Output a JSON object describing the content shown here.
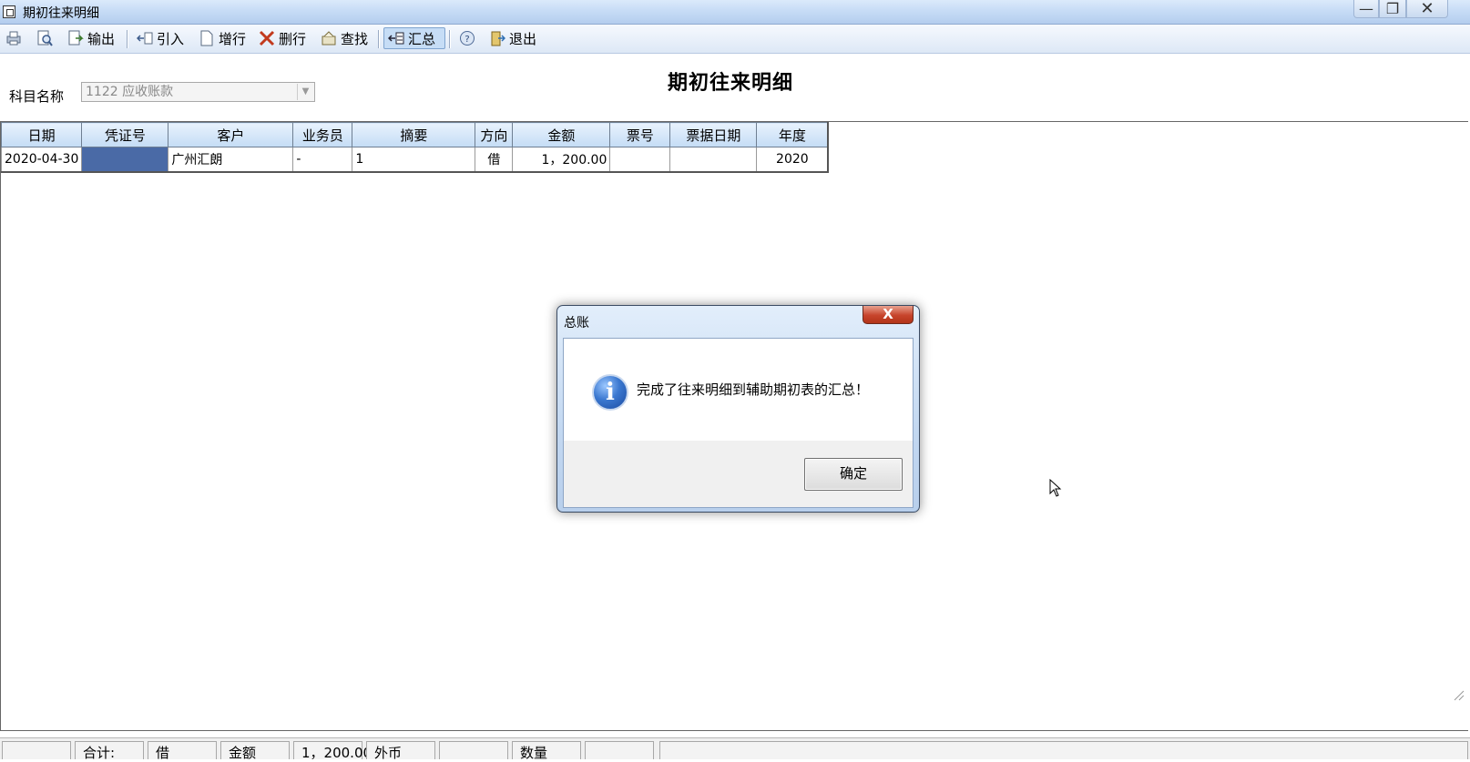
{
  "window": {
    "title": "期初往来明细",
    "controls": {
      "minimize": "—",
      "maximize": "❐",
      "close": "✕"
    }
  },
  "toolbar": {
    "items": [
      {
        "name": "print",
        "label": ""
      },
      {
        "name": "preview",
        "label": ""
      },
      {
        "name": "export",
        "label": "输出"
      },
      {
        "name": "import",
        "label": "引入"
      },
      {
        "name": "add-row",
        "label": "增行"
      },
      {
        "name": "delete-row",
        "label": "删行"
      },
      {
        "name": "find",
        "label": "查找"
      },
      {
        "name": "summarize",
        "label": "汇总"
      },
      {
        "name": "help",
        "label": ""
      },
      {
        "name": "exit",
        "label": "退出"
      }
    ]
  },
  "page": {
    "heading": "期初往来明细",
    "subject_label": "科目名称",
    "subject_value": "1122 应收账款"
  },
  "grid": {
    "columns": [
      "日期",
      "凭证号",
      "客户",
      "业务员",
      "摘要",
      "方向",
      "金额",
      "票号",
      "票据日期",
      "年度"
    ],
    "rows": [
      {
        "date": "2020-04-30",
        "voucher": "",
        "customer": "广州汇朗",
        "salesperson": "-",
        "summary": "1",
        "direction": "借",
        "amount": "1，200.00",
        "ticket_no": "",
        "ticket_date": "",
        "year": "2020"
      }
    ]
  },
  "statusbar": {
    "total_label": "合计:",
    "direction": "借",
    "amount_label": "金额",
    "amount_value": "1，200.00",
    "foreign_label": "外币",
    "foreign_value": "",
    "quantity_label": "数量",
    "quantity_value": ""
  },
  "dialog": {
    "title": "总账",
    "message": "完成了往来明细到辅助期初表的汇总！",
    "ok_label": "确定",
    "close_glyph": "X",
    "icon_glyph": "i"
  },
  "colors": {
    "selected_cell": "#4a6aa6",
    "header_gradient_top": "#e8f2fd",
    "header_gradient_bottom": "#c4dcf5"
  }
}
